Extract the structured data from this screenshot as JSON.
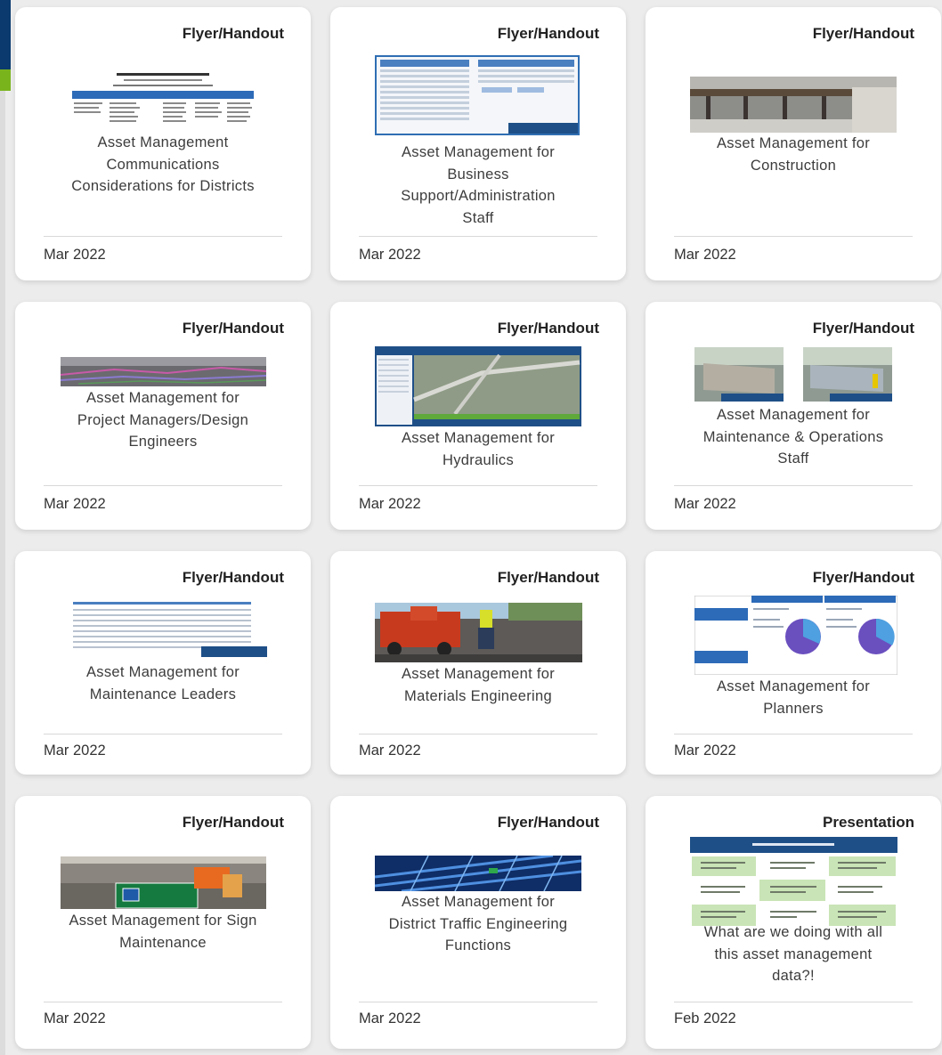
{
  "cards": [
    {
      "type": "Flyer/Handout",
      "title_lines": [
        "Asset Management",
        "Communications",
        "Considerations for Districts"
      ],
      "date": "Mar 2022",
      "thumb": "document-table-thumbnail"
    },
    {
      "type": "Flyer/Handout",
      "title_lines": [
        "Asset Management for",
        "Business",
        "Support/Administration",
        "Staff"
      ],
      "date": "Mar 2022",
      "thumb": "spreadsheet-thumbnail"
    },
    {
      "type": "Flyer/Handout",
      "title_lines": [
        "Asset Management for",
        "Construction"
      ],
      "date": "Mar 2022",
      "thumb": "bridge-construction-photo"
    },
    {
      "type": "Flyer/Handout",
      "title_lines": [
        "Asset Management for",
        "Project Managers/Design",
        "Engineers"
      ],
      "date": "Mar 2022",
      "thumb": "highway-point-cloud-photo"
    },
    {
      "type": "Flyer/Handout",
      "title_lines": [
        "Asset Management for",
        "Hydraulics"
      ],
      "date": "Mar 2022",
      "thumb": "map-viewer-screenshot"
    },
    {
      "type": "Flyer/Handout",
      "title_lines": [
        "Asset Management for",
        "Maintenance & Operations",
        "Staff"
      ],
      "date": "Mar 2022",
      "thumb": "before-after-wall-photos"
    },
    {
      "type": "Flyer/Handout",
      "title_lines": [
        "Asset Management for",
        "Maintenance Leaders"
      ],
      "date": "Mar 2022",
      "thumb": "data-table-thumbnail"
    },
    {
      "type": "Flyer/Handout",
      "title_lines": [
        "Asset Management for",
        "Materials Engineering"
      ],
      "date": "Mar 2022",
      "thumb": "road-crew-photo"
    },
    {
      "type": "Flyer/Handout",
      "title_lines": [
        "Asset Management for",
        "Planners"
      ],
      "date": "Mar 2022",
      "thumb": "pie-chart-comparison-thumbnail"
    },
    {
      "type": "Flyer/Handout",
      "title_lines": [
        "Asset Management for Sign",
        "Maintenance"
      ],
      "date": "Mar 2022",
      "thumb": "sign-maintenance-photo"
    },
    {
      "type": "Flyer/Handout",
      "title_lines": [
        "Asset Management for",
        "District Traffic Engineering",
        "Functions"
      ],
      "date": "Mar 2022",
      "thumb": "traffic-structure-photo"
    },
    {
      "type": "Presentation",
      "title_lines": [
        "What are we doing with all",
        "this asset management",
        "data?!"
      ],
      "date": "Feb 2022",
      "thumb": "slide-thumbnail"
    }
  ],
  "colors": {
    "page_bg": "#ececec",
    "card_bg": "#ffffff",
    "brand_blue": "#0a3a6e",
    "brand_green": "#7ab41d"
  }
}
